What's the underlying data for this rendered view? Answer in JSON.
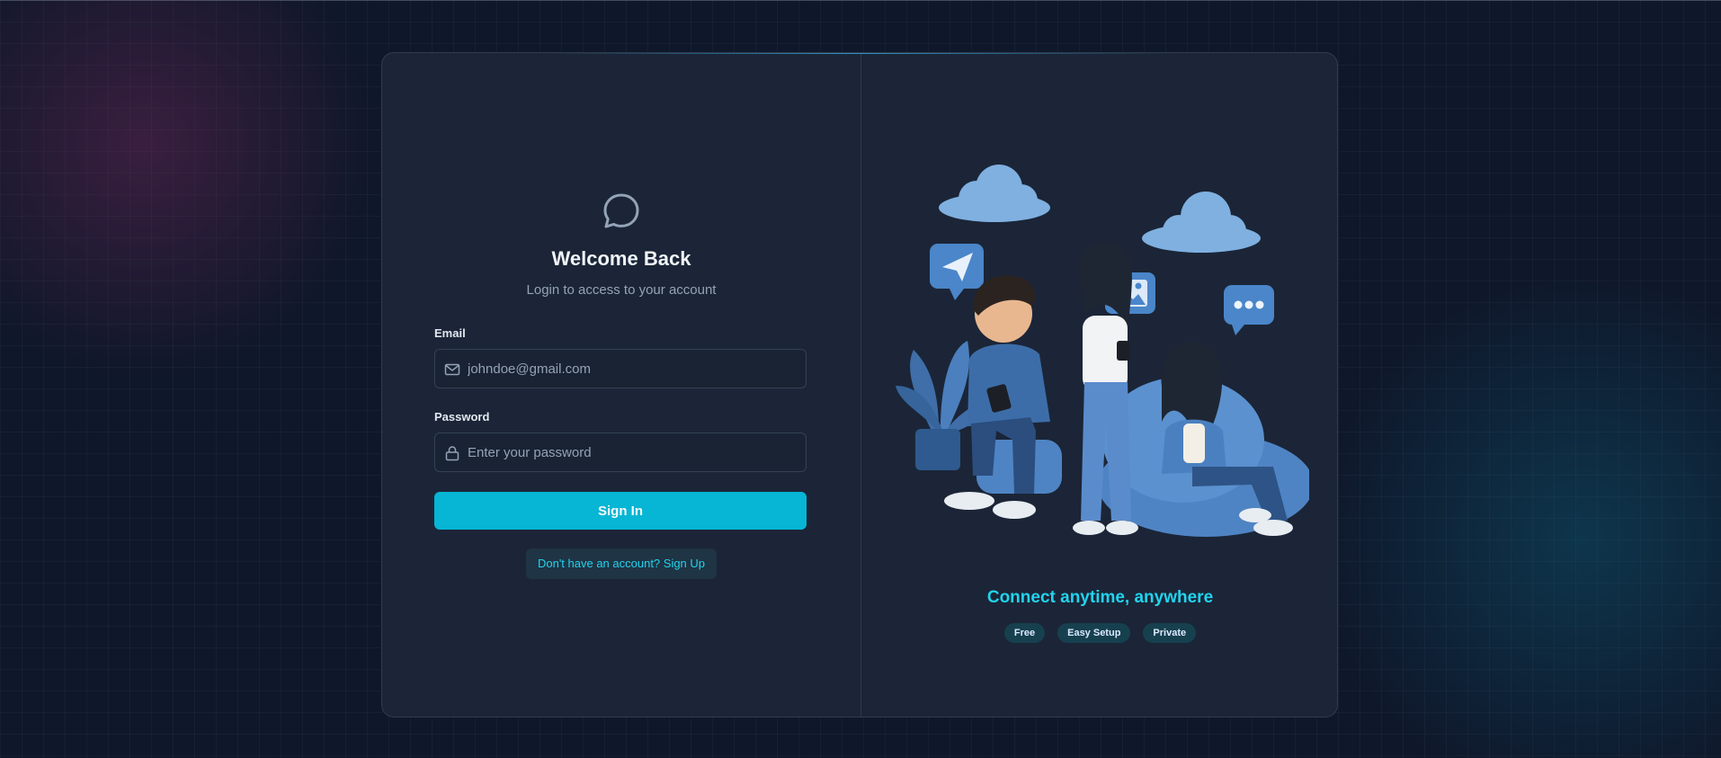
{
  "login": {
    "title": "Welcome Back",
    "subtitle": "Login to access to your account",
    "email_label": "Email",
    "email_placeholder": "johndoe@gmail.com",
    "password_label": "Password",
    "password_placeholder": "Enter your password",
    "signin_label": "Sign In",
    "signup_link": "Don't have an account? Sign Up",
    "logo_icon": "chat-bubble-icon"
  },
  "promo": {
    "tagline": "Connect anytime, anywhere",
    "badges": [
      "Free",
      "Easy Setup",
      "Private"
    ],
    "illustration": "people-chatting-illustration"
  },
  "colors": {
    "accent": "#06b6d4",
    "accent_text": "#22d3ee",
    "card_bg": "#1b2537",
    "page_bg": "#0f172a"
  }
}
